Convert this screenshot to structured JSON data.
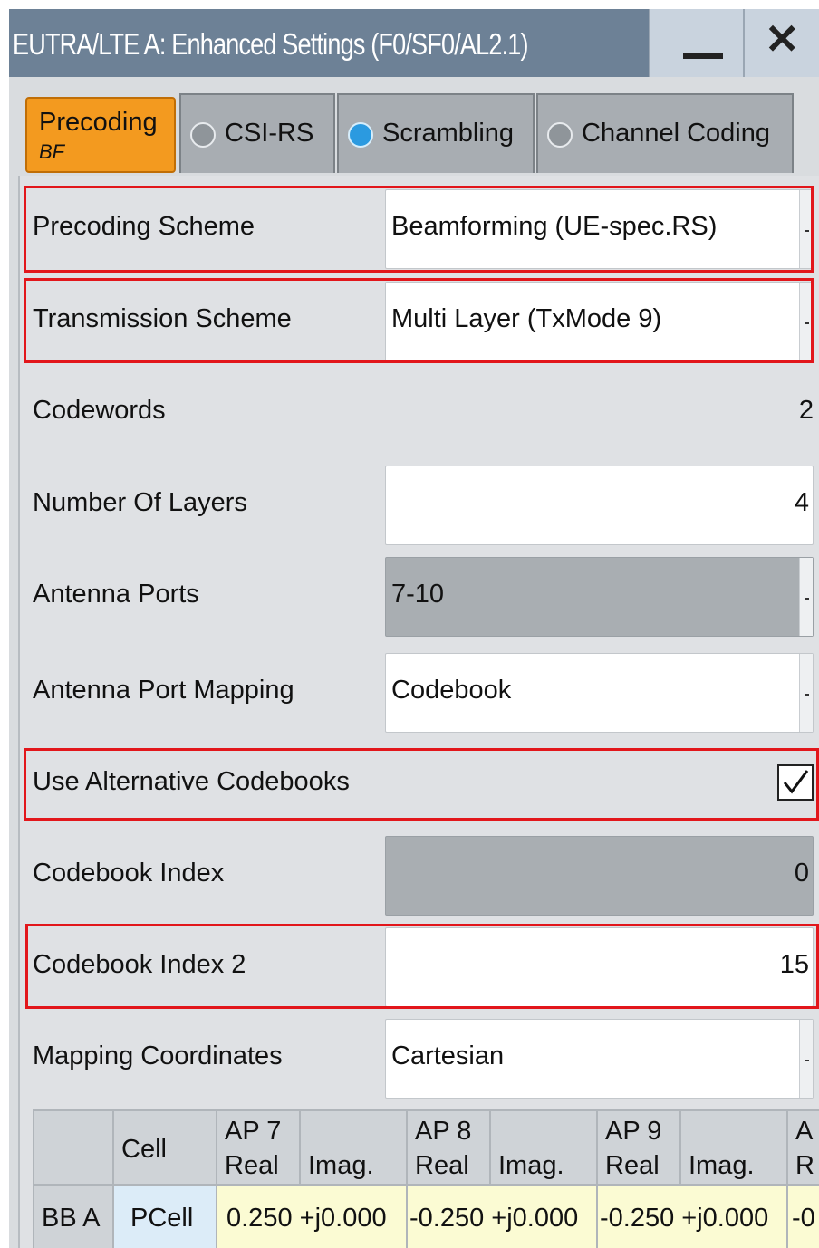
{
  "window": {
    "title": "EUTRA/LTE A: Enhanced Settings (F0/SF0/AL2.1)",
    "minimize_icon": "minimize-icon",
    "close_icon": "close-icon",
    "close_glyph": "✕"
  },
  "tabs": [
    {
      "label": "Precoding",
      "sublabel": "BF",
      "active": true
    },
    {
      "label": "CSI-RS",
      "indicator": "off"
    },
    {
      "label": "Scrambling",
      "indicator": "on"
    },
    {
      "label": "Channel Coding",
      "indicator": "off"
    }
  ],
  "form": {
    "precoding_scheme": {
      "label": "Precoding Scheme",
      "value": "Beamforming (UE-spec.RS)"
    },
    "transmission_scheme": {
      "label": "Transmission Scheme",
      "value": "Multi Layer (TxMode 9)"
    },
    "codewords": {
      "label": "Codewords",
      "value": "2"
    },
    "number_of_layers": {
      "label": "Number Of Layers",
      "value": "4"
    },
    "antenna_ports": {
      "label": "Antenna Ports",
      "value": "7-10"
    },
    "antenna_port_mapping": {
      "label": "Antenna Port Mapping",
      "value": "Codebook"
    },
    "use_alternative_codebooks": {
      "label": "Use Alternative Codebooks",
      "checked": true
    },
    "codebook_index": {
      "label": "Codebook Index",
      "value": "0"
    },
    "codebook_index_2": {
      "label": "Codebook Index 2",
      "value": "15"
    },
    "mapping_coordinates": {
      "label": "Mapping Coordinates",
      "value": "Cartesian"
    }
  },
  "table": {
    "headers": {
      "cell": "Cell",
      "ap7": "AP 7",
      "ap8": "AP 8",
      "ap9": "AP 9",
      "ap10_partial": "A",
      "real": "Real",
      "imag": "Imag.",
      "real_partial": "R"
    },
    "rows": [
      {
        "name": "BB A",
        "cell": "PCell",
        "ap7": "0.250 +j0.000",
        "ap8": "-0.250 +j0.000",
        "ap9": "-0.250 +j0.000",
        "ap10_partial": "-0"
      }
    ]
  },
  "colors": {
    "titlebar": "#6d8196",
    "active_tab": "#f39a1f",
    "highlight_box": "#e2161b",
    "indicator_on": "#2b9ae0"
  }
}
